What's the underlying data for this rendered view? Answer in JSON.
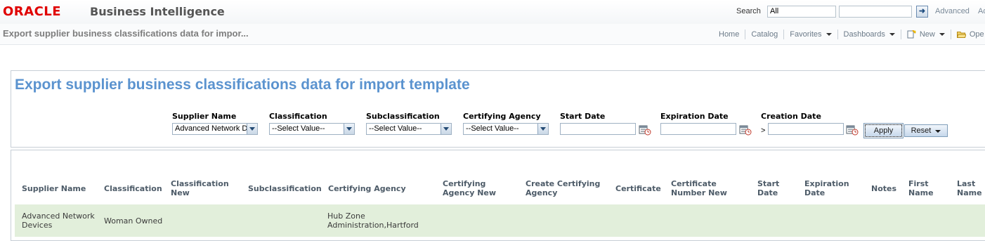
{
  "header": {
    "logo_text": "ORACLE",
    "product_name": "Business Intelligence",
    "search_label": "Search",
    "search_scope": "All",
    "search_placeholder": "",
    "advanced_label": "Advanced",
    "admin_label": "Ad"
  },
  "subheader": {
    "page_heading": "Export supplier business classifications data for impor...",
    "nav": {
      "home": "Home",
      "catalog": "Catalog",
      "favorites": "Favorites",
      "dashboards": "Dashboards",
      "new": "New",
      "open": "Ope"
    }
  },
  "prompts": {
    "title": "Export supplier business classifications data for import template",
    "supplier_name": {
      "label": "Supplier Name",
      "value": "Advanced Network D"
    },
    "classification": {
      "label": "Classification",
      "value": "--Select Value--"
    },
    "subclassification": {
      "label": "Subclassification",
      "value": "--Select Value--"
    },
    "certifying_agency": {
      "label": "Certifying Agency",
      "value": "--Select Value--"
    },
    "start_date": {
      "label": "Start Date",
      "value": ""
    },
    "expiration_date": {
      "label": "Expiration Date",
      "value": ""
    },
    "creation_date": {
      "label": "Creation Date",
      "operator": ">",
      "value": ""
    },
    "apply_label": "Apply",
    "reset_label": "Reset"
  },
  "table": {
    "columns": {
      "supplier_name": "Supplier Name",
      "classification": "Classification",
      "classification_new_1": "Classification",
      "classification_new_2": "New",
      "subclassification": "Subclassification",
      "certifying_agency": "Certifying Agency",
      "certifying_agency_new_1": "Certifying",
      "certifying_agency_new_2": "Agency New",
      "create_certifying_agency_1": "Create Certifying",
      "create_certifying_agency_2": "Agency",
      "certificate": "Certificate",
      "certificate_number_new_1": "Certificate",
      "certificate_number_new_2": "Number New",
      "start_date_1": "Start",
      "start_date_2": "Date",
      "expiration_date_1": "Expiration",
      "expiration_date_2": "Date",
      "notes": "Notes",
      "first_name_1": "First",
      "first_name_2": "Name",
      "last_name_1": "Last",
      "last_name_2": "Name"
    },
    "rows": [
      {
        "supplier_name_1": "Advanced Network",
        "supplier_name_2": "Devices",
        "classification": "Woman Owned",
        "certifying_agency_1": "Hub Zone",
        "certifying_agency_2": "Administration,Hartford"
      }
    ]
  },
  "colors": {
    "brand_red": "#e00000",
    "title_blue": "#5b93cf",
    "row_green": "#e2efdb"
  }
}
